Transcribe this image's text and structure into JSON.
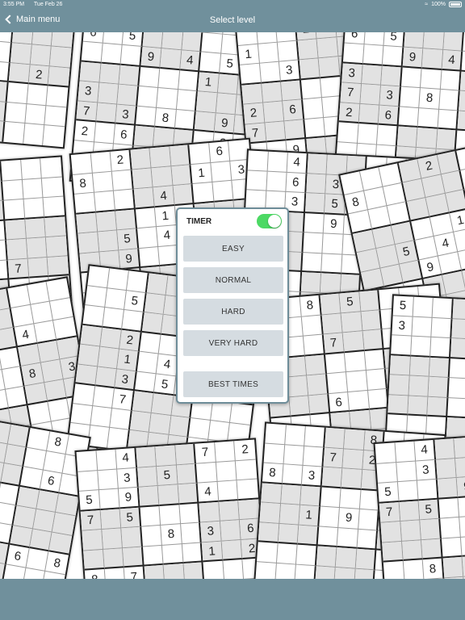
{
  "status_bar": {
    "time": "3:55 PM",
    "date": "Tue Feb 26",
    "battery": "100%"
  },
  "nav": {
    "back_label": "Main menu",
    "title": "Select level"
  },
  "menu": {
    "timer_label": "TIMER",
    "timer_on": true,
    "levels": [
      "EASY",
      "NORMAL",
      "HARD",
      "VERY HARD"
    ],
    "best_times_label": "BEST TIMES"
  },
  "colors": {
    "bar": "#70909c",
    "toggle_on": "#4cd964",
    "button": "#d5dce1"
  },
  "background_puzzles": [
    [
      "   2 7   ",
      "3        ",
      "       8 ",
      "         ",
      "  9      ",
      "       2 ",
      "         ",
      "         ",
      "         "
    ],
    [
      "4        ",
      "6 5      ",
      "   9 4 5 ",
      "      1  ",
      "3        ",
      "7 3 8  9 ",
      "2 6    3 ",
      "         ",
      "       9 "
    ],
    [
      "   2 7   ",
      "1        ",
      "  3      ",
      "       8 ",
      "2 6      ",
      "7        ",
      "  9      ",
      "     2 3 ",
      "         "
    ],
    [
      "4        ",
      "6 5      ",
      "   9 4 5 ",
      "3        ",
      "7 3 8 9  ",
      "2 6    3 ",
      "       2 ",
      "         ",
      "         "
    ],
    [
      "3  9     ",
      "5  6 8   ",
      "9   6    ",
      "   9     ",
      "         ",
      "      7  ",
      "5        ",
      "         ",
      "         "
    ],
    [
      "  2    6 ",
      "8     1 3",
      "    4    ",
      "    1    ",
      "  5 4  8 ",
      "  9   6  ",
      "         ",
      "         ",
      "         "
    ],
    [
      "  4      ",
      "  6 3  9 ",
      "  3 5  6 ",
      "    9    ",
      "         ",
      "      2  ",
      "      8 5",
      "         ",
      "         "
    ],
    [
      "    2  1 ",
      "8      4 ",
      "         ",
      "     1   ",
      "  5 4  8 ",
      "   9   6 ",
      "         ",
      "         ",
      "         "
    ],
    [
      "5        ",
      "3        ",
      "      4  ",
      "6        ",
      "      8 3",
      "         ",
      "         ",
      "         ",
      "         "
    ],
    [
      "     7   ",
      "  5      ",
      "       1 ",
      "  2      ",
      "  1 4    ",
      "  3 5    ",
      "  7      ",
      "         ",
      "         "
    ],
    [
      "  8 5    ",
      "4      3 ",
      "   7     ",
      "      4  ",
      "7        ",
      "   6     ",
      "       8 ",
      "         ",
      "         "
    ],
    [
      "5        ",
      "3        ",
      "         ",
      "         ",
      "         ",
      "         ",
      "       1 4",
      "         ",
      "         "
    ],
    [
      "7 2    8 ",
      "  9      ",
      "       6 ",
      "9 2      ",
      "         ",
      "    4    ",
      "   3  6 8",
      "         ",
      "         "
    ],
    [
      "  4   7 2",
      "  3 5    ",
      "5 9   4  ",
      "7 5      ",
      "    8 3 6",
      "      1 2",
      "8 7      ",
      "         ",
      "         "
    ],
    [
      "     8   ",
      "   7 2   ",
      "8 3   9  ",
      "         ",
      "  1 9 2  ",
      "         ",
      "         ",
      "       3 ",
      "         "
    ],
    [
      "  4   5  ",
      "  3      ",
      "5   9    ",
      "7 5      ",
      "    8    ",
      "    1 2  ",
      "  8 7    ",
      "         ",
      "         "
    ]
  ]
}
